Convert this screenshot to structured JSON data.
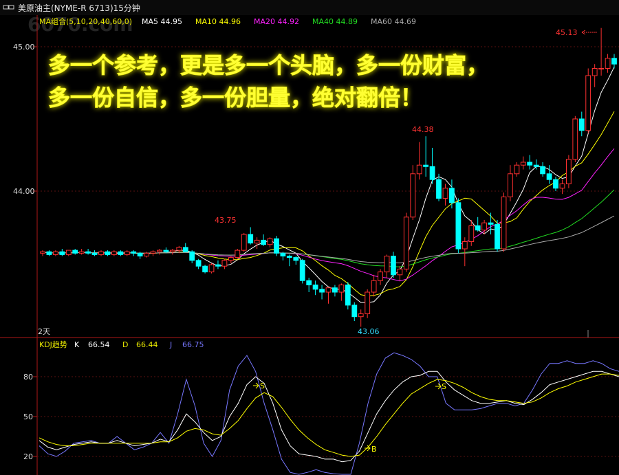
{
  "window": {
    "title_icon": "restore-window-icon",
    "title": "美原油主(NYME-R 6713)15分钟",
    "watermark": "6070.com"
  },
  "ma_legend": {
    "group_label": "MA组合(5,10,20,40,60,0)",
    "items": [
      {
        "label": "MA5 44.95",
        "color": "#ffffff"
      },
      {
        "label": "MA10 44.96",
        "color": "#ffff00"
      },
      {
        "label": "MA20 44.92",
        "color": "#ff22ff"
      },
      {
        "label": "MA40 44.89",
        "color": "#22dd22"
      },
      {
        "label": "MA60 44.69",
        "color": "#aaaaaa"
      }
    ]
  },
  "banner": {
    "line1": "多一个参考，更是多一个头脑，多一份财富，",
    "line2": "多一份自信，多一份胆量，绝对翻倍！"
  },
  "price_axis": {
    "ticks": [
      "45.00",
      "44.00"
    ]
  },
  "annotations": {
    "high_marker": "45.13",
    "peak1": "43.75",
    "peak2": "44.38",
    "low": "43.06",
    "period_label": "2天"
  },
  "kdj": {
    "title": "KDJ趋势",
    "k_label": "K",
    "k_value": "66.54",
    "d_label": "D",
    "d_value": "66.44",
    "j_label": "J",
    "j_value": "66.75",
    "ticks": [
      "80",
      "50",
      "20"
    ],
    "signals": [
      "S",
      "S",
      "B"
    ]
  },
  "colors": {
    "up": "#ff3030",
    "down": "#00ffff",
    "axis": "#b01818",
    "k": "#ffffff",
    "d": "#ffff00",
    "j": "#7777ff",
    "banner_text": "#ffff33",
    "banner_glow": "#d8d800"
  },
  "chart_data": {
    "type": "candlestick",
    "ylim": [
      43.0,
      45.2
    ],
    "candles": [
      [
        43.57,
        43.59,
        43.55,
        43.58
      ],
      [
        43.58,
        43.59,
        43.55,
        43.56
      ],
      [
        43.56,
        43.59,
        43.55,
        43.58
      ],
      [
        43.58,
        43.6,
        43.55,
        43.56
      ],
      [
        43.56,
        43.59,
        43.55,
        43.59
      ],
      [
        43.59,
        43.6,
        43.56,
        43.57
      ],
      [
        43.57,
        43.6,
        43.56,
        43.58
      ],
      [
        43.58,
        43.6,
        43.56,
        43.57
      ],
      [
        43.57,
        43.59,
        43.55,
        43.56
      ],
      [
        43.56,
        43.59,
        43.55,
        43.58
      ],
      [
        43.58,
        43.59,
        43.55,
        43.56
      ],
      [
        43.56,
        43.59,
        43.55,
        43.58
      ],
      [
        43.58,
        43.59,
        43.55,
        43.56
      ],
      [
        43.56,
        43.59,
        43.55,
        43.58
      ],
      [
        43.58,
        43.59,
        43.55,
        43.57
      ],
      [
        43.57,
        43.58,
        43.53,
        43.55
      ],
      [
        43.55,
        43.58,
        43.54,
        43.57
      ],
      [
        43.57,
        43.59,
        43.55,
        43.58
      ],
      [
        43.58,
        43.6,
        43.56,
        43.59
      ],
      [
        43.59,
        43.61,
        43.57,
        43.58
      ],
      [
        43.58,
        43.6,
        43.56,
        43.59
      ],
      [
        43.59,
        43.62,
        43.57,
        43.61
      ],
      [
        43.61,
        43.64,
        43.58,
        43.58
      ],
      [
        43.58,
        43.59,
        43.5,
        43.52
      ],
      [
        43.52,
        43.53,
        43.46,
        43.48
      ],
      [
        43.48,
        43.49,
        43.43,
        43.44
      ],
      [
        43.44,
        43.5,
        43.43,
        43.49
      ],
      [
        43.49,
        43.52,
        43.46,
        43.48
      ],
      [
        43.48,
        43.53,
        43.46,
        43.52
      ],
      [
        43.52,
        43.55,
        43.5,
        43.54
      ],
      [
        43.54,
        43.6,
        43.53,
        43.59
      ],
      [
        43.59,
        43.71,
        43.58,
        43.7
      ],
      [
        43.7,
        43.75,
        43.63,
        43.64
      ],
      [
        43.64,
        43.68,
        43.6,
        43.66
      ],
      [
        43.66,
        43.7,
        43.62,
        43.63
      ],
      [
        43.63,
        43.68,
        43.61,
        43.67
      ],
      [
        43.67,
        43.69,
        43.55,
        43.57
      ],
      [
        43.57,
        43.58,
        43.52,
        43.55
      ],
      [
        43.55,
        43.56,
        43.48,
        43.54
      ],
      [
        43.54,
        43.55,
        43.49,
        43.52
      ],
      [
        43.52,
        43.53,
        43.36,
        43.38
      ],
      [
        43.38,
        43.4,
        43.3,
        43.35
      ],
      [
        43.35,
        43.38,
        43.28,
        43.32
      ],
      [
        43.32,
        43.35,
        43.25,
        43.3
      ],
      [
        43.3,
        43.33,
        43.22,
        43.33
      ],
      [
        43.33,
        43.35,
        43.27,
        43.3
      ],
      [
        43.3,
        43.36,
        43.24,
        43.35
      ],
      [
        43.35,
        43.37,
        43.18,
        43.21
      ],
      [
        43.21,
        43.23,
        43.1,
        43.13
      ],
      [
        43.13,
        43.18,
        43.06,
        43.15
      ],
      [
        43.15,
        43.32,
        43.12,
        43.3
      ],
      [
        43.3,
        43.42,
        43.27,
        43.38
      ],
      [
        43.38,
        43.46,
        43.35,
        43.44
      ],
      [
        43.44,
        43.56,
        43.4,
        43.55
      ],
      [
        43.55,
        43.58,
        43.4,
        43.42
      ],
      [
        43.42,
        43.48,
        43.38,
        43.46
      ],
      [
        43.46,
        43.85,
        43.44,
        43.82
      ],
      [
        43.82,
        44.18,
        43.8,
        44.12
      ],
      [
        44.12,
        44.34,
        44.08,
        44.18
      ],
      [
        44.18,
        44.38,
        44.1,
        44.17
      ],
      [
        44.17,
        44.3,
        44.05,
        44.08
      ],
      [
        44.08,
        44.12,
        43.93,
        43.95
      ],
      [
        43.95,
        44.05,
        43.9,
        44.02
      ],
      [
        44.02,
        44.08,
        43.88,
        43.92
      ],
      [
        43.92,
        43.95,
        43.57,
        43.6
      ],
      [
        43.6,
        43.68,
        43.48,
        43.65
      ],
      [
        43.65,
        43.8,
        43.62,
        43.76
      ],
      [
        43.76,
        43.82,
        43.72,
        43.73
      ],
      [
        43.73,
        43.8,
        43.7,
        43.78
      ],
      [
        43.78,
        43.85,
        43.7,
        43.77
      ],
      [
        43.77,
        43.8,
        43.58,
        43.6
      ],
      [
        43.6,
        43.99,
        43.58,
        43.96
      ],
      [
        43.96,
        44.18,
        43.93,
        44.12
      ],
      [
        44.12,
        44.2,
        44.1,
        44.18
      ],
      [
        44.18,
        44.24,
        44.15,
        44.2
      ],
      [
        44.2,
        44.25,
        44.15,
        44.18
      ],
      [
        44.18,
        44.22,
        44.15,
        44.17
      ],
      [
        44.17,
        44.2,
        44.1,
        44.12
      ],
      [
        44.12,
        44.18,
        44.05,
        44.08
      ],
      [
        44.08,
        44.1,
        44.0,
        44.02
      ],
      [
        44.02,
        44.08,
        43.98,
        44.05
      ],
      [
        44.05,
        44.25,
        44.02,
        44.22
      ],
      [
        44.22,
        44.52,
        44.2,
        44.5
      ],
      [
        44.5,
        44.55,
        44.38,
        44.42
      ],
      [
        44.42,
        44.85,
        44.4,
        44.8
      ],
      [
        44.8,
        44.88,
        44.72,
        44.85
      ],
      [
        44.85,
        45.13,
        44.8,
        44.85
      ],
      [
        44.85,
        44.95,
        44.82,
        44.92
      ],
      [
        44.92,
        44.95,
        44.85,
        44.88
      ]
    ],
    "kdj": {
      "k": [
        32,
        27,
        25,
        27,
        29,
        30,
        31,
        30,
        30,
        32,
        30,
        28,
        29,
        30,
        33,
        31,
        40,
        52,
        46,
        38,
        32,
        35,
        50,
        60,
        74,
        80,
        75,
        60,
        40,
        28,
        22,
        21,
        20,
        18,
        18,
        16,
        17,
        24,
        38,
        52,
        62,
        70,
        76,
        80,
        81,
        84,
        84,
        76,
        70,
        66,
        62,
        60,
        60,
        61,
        62,
        60,
        59,
        63,
        68,
        74,
        76,
        78,
        80,
        82,
        84,
        84,
        82,
        80
      ],
      "d": [
        34,
        31,
        29,
        28,
        28,
        29,
        30,
        30,
        30,
        30,
        30,
        30,
        30,
        30,
        31,
        31,
        34,
        39,
        41,
        40,
        37,
        36,
        41,
        47,
        56,
        64,
        68,
        65,
        57,
        48,
        40,
        34,
        29,
        25,
        23,
        21,
        20,
        21,
        27,
        35,
        44,
        52,
        60,
        67,
        71,
        75,
        78,
        77,
        75,
        72,
        68,
        65,
        63,
        62,
        62,
        61,
        60,
        61,
        64,
        68,
        71,
        73,
        76,
        78,
        80,
        82,
        82,
        81
      ],
      "j": [
        28,
        22,
        20,
        24,
        30,
        31,
        32,
        30,
        30,
        35,
        30,
        25,
        27,
        30,
        38,
        30,
        52,
        78,
        58,
        30,
        20,
        32,
        70,
        88,
        96,
        84,
        60,
        40,
        18,
        8,
        6,
        8,
        10,
        8,
        7,
        5,
        6,
        30,
        60,
        82,
        94,
        98,
        96,
        93,
        88,
        80,
        80,
        60,
        55,
        55,
        55,
        56,
        58,
        60,
        60,
        58,
        60,
        70,
        82,
        90,
        90,
        92,
        90,
        90,
        92,
        90,
        86,
        84
      ]
    }
  }
}
